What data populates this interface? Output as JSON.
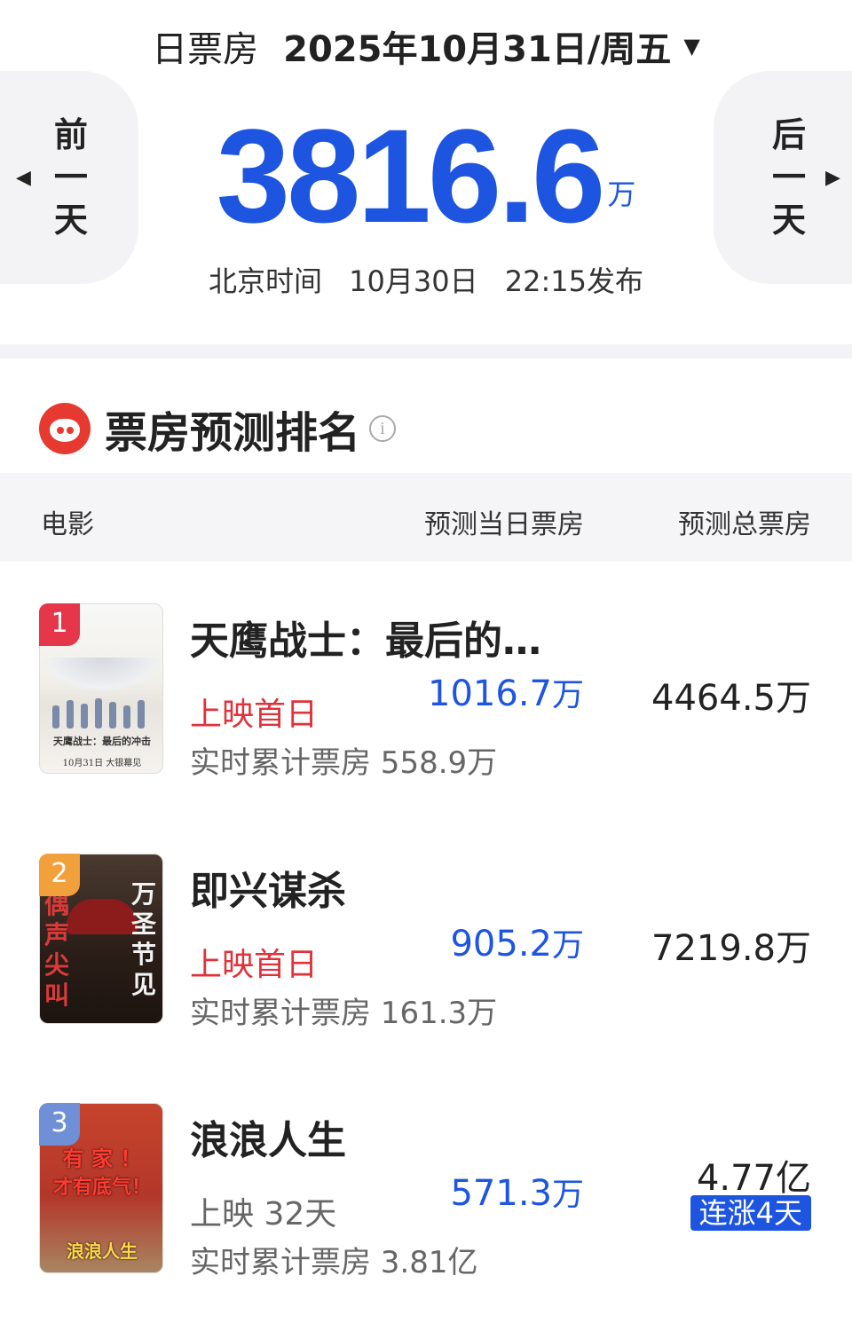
{
  "header": {
    "label": "日票房",
    "date": "2025年10月31日/周五",
    "prev_chars": [
      "前",
      "一",
      "天"
    ],
    "next_chars": [
      "后",
      "一",
      "天"
    ],
    "total_value": "3816.6",
    "total_unit": "万",
    "publish_prefix": "北京时间",
    "publish_date": "10月30日",
    "publish_time": "22:15发布"
  },
  "section": {
    "title": "票房预测排名",
    "info_glyph": "i",
    "columns": [
      "电影",
      "预测当日票房",
      "预测总票房"
    ]
  },
  "movies": [
    {
      "rank": "1",
      "title": "天鹰战士：最后的…",
      "release": "上映首日",
      "cumulative": "实时累计票房 558.9万",
      "today_value": "1016.7",
      "today_unit": "万",
      "total": "4464.5万",
      "poster_lines": [
        "天鹰战士：最后的冲击",
        "10月31日 大银幕见"
      ]
    },
    {
      "rank": "2",
      "title": "即兴谋杀",
      "release": "上映首日",
      "cumulative": "实时累计票房 161.3万",
      "today_value": "905.2",
      "today_unit": "万",
      "total": "7219.8万",
      "poster_left": [
        "偶",
        "声",
        "尖",
        "叫"
      ],
      "poster_right": [
        "万",
        "圣",
        "节",
        "见"
      ]
    },
    {
      "rank": "3",
      "title": "浪浪人生",
      "release": "上映 32天",
      "cumulative": "实时累计票房 3.81亿",
      "today_value": "571.3",
      "today_unit": "万",
      "total": "4.77亿",
      "badge": "连涨4天",
      "poster_lines": [
        "有 家 ！",
        "才有底气！",
        "浪浪人生"
      ]
    }
  ],
  "colors": {
    "accent_blue": "#1e55e0",
    "accent_red": "#e0323a",
    "rank1": "#e5364a",
    "rank2": "#f2a03b",
    "rank3": "#6f8fd6"
  }
}
